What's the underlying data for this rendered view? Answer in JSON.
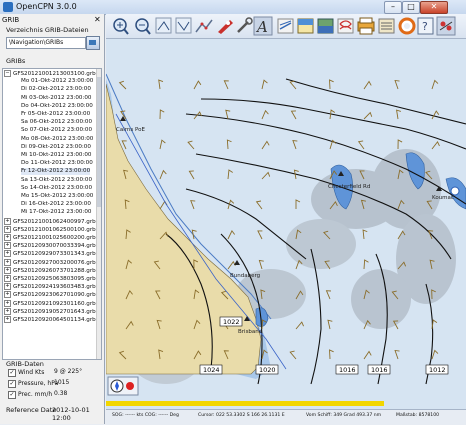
{
  "window": {
    "title": "OpenCPN 3.0.0",
    "minimize": "–",
    "maximize": "□",
    "close": "✕"
  },
  "grib": {
    "panel_title": "GRIB",
    "close": "✕",
    "dir_label": "Verzeichnis GRIB-Dateien",
    "dir_value": "\\Navigation\\GRIBs",
    "list_label": "GRIBs",
    "root": "GFS20121001213003100.grb",
    "times": [
      "Mo 01-Okt-2012 23:00:00",
      "Di 02-Okt-2012 23:00:00",
      "Mi 03-Okt-2012 23:00:00",
      "Do 04-Okt-2012 23:00:00",
      "Fr 05-Okt-2012 23:00:00",
      "Sa 06-Okt-2012 23:00:00",
      "So 07-Okt-2012 23:00:00",
      "Mo 08-Okt-2012 23:00:00",
      "Di 09-Okt-2012 23:00:00",
      "Mi 10-Okt-2012 23:00:00",
      "Do 11-Okt-2012 23:00:00",
      "Fr 12-Okt-2012 23:00:00",
      "Sa 13-Okt-2012 23:00:00",
      "So 14-Okt-2012 23:00:00",
      "Mo 15-Okt-2012 23:00:00",
      "Di 16-Okt-2012 23:00:00",
      "Mi 17-Okt-2012 23:00:00"
    ],
    "files": [
      "GFS20121001062400997.grb",
      "GFS20121001062500100.grb",
      "GFS20121001025600200.grb",
      "GFS20120930070033394.grb",
      "GFS20120929073301343.grb",
      "GFS20120927003200076.grb",
      "GFS20120926073701288.grb",
      "GFS20120925063803095.grb",
      "GFS20120924193603483.grb",
      "GFS20120923062701090.grb",
      "GFS20120921092301160.grb",
      "GFS20120919052701643.grb",
      "GFS20120920064501134.grb"
    ],
    "data_label": "GRIB-Daten",
    "wind_label": "Wind Kts",
    "wind_value": "9 @ 225°",
    "pressure_label": "Pressure, hPa",
    "pressure_value": "1015",
    "prec_label": "Prec. mm/h",
    "prec_value": "0.38",
    "ref_label": "Reference Date",
    "ref_value": "2012-10-01 12:00"
  },
  "chart_labels": {
    "isobars": [
      "1024",
      "1020",
      "1016",
      "1016",
      "1012",
      "1022"
    ],
    "places": [
      "Cairns PoE",
      "Chesterfield Rd",
      "Koumac",
      "Bundaberg",
      "Brisbane"
    ]
  },
  "status": {
    "sog": "SOG: ------ kts  COG: ------ Deg",
    "cursor": "Cursor: 022 53.3302 S 166 26.1131 E",
    "ship": "Vom Schiff: 349 Grad  493.37 nm",
    "scale": "Maßstab: 8578100"
  },
  "colors": {
    "land": "#e9dcaa",
    "water": "#d6e4f2",
    "shallow": "#a9c8ea",
    "deep": "#5f94d8",
    "isobar": "#111111",
    "wind": "#8a6d2a",
    "accent": "#f2d600"
  }
}
